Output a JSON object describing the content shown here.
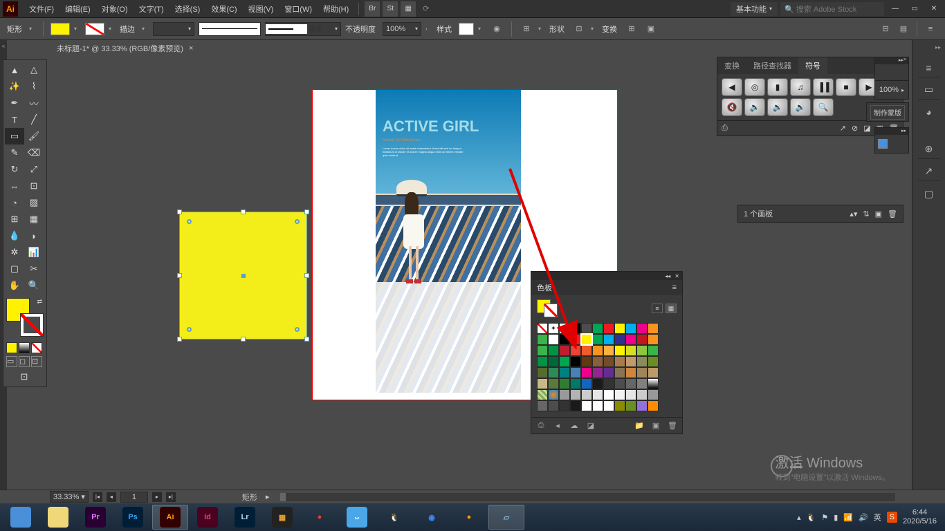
{
  "menubar": {
    "items": [
      "文件(F)",
      "编辑(E)",
      "对象(O)",
      "文字(T)",
      "选择(S)",
      "效果(C)",
      "视图(V)",
      "窗口(W)",
      "帮助(H)"
    ],
    "bridge": "Br",
    "stock": "St",
    "workspace": "基本功能",
    "search_placeholder": "搜索 Adobe Stock"
  },
  "control": {
    "shape_label": "矩形",
    "fill_color": "#fff200",
    "stroke_label": "描边",
    "stroke_weight": "",
    "stroke_style": "基本",
    "opacity_label": "不透明度",
    "opacity_value": "100%",
    "style_label": "样式",
    "align_label": "形状",
    "transform_label": "变换"
  },
  "tab": {
    "title": "未标题-1* @ 33.33% (RGB/像素预览)"
  },
  "tools": {
    "rows": [
      [
        "selection",
        "direct-selection"
      ],
      [
        "magic-wand",
        "lasso"
      ],
      [
        "pen",
        "curvature"
      ],
      [
        "type",
        "line"
      ],
      [
        "rectangle",
        "brush"
      ],
      [
        "shaper",
        "eraser"
      ],
      [
        "rotate",
        "scale"
      ],
      [
        "width",
        "free-transform"
      ],
      [
        "shape-builder",
        "perspective"
      ],
      [
        "mesh",
        "gradient"
      ],
      [
        "eyedropper",
        "blend"
      ],
      [
        "symbol-sprayer",
        "graph"
      ],
      [
        "artboard",
        "slice"
      ],
      [
        "hand",
        "zoom"
      ]
    ],
    "active": "rectangle",
    "fill_color": "#fff200",
    "mini_colors": [
      "#000000",
      "#ffffff",
      "none"
    ]
  },
  "canvas": {
    "poster_title": "ACTIVE GIRL",
    "poster_subtitle": "Actively Girl With Dream",
    "yellow_rect_color": "#f3ed19"
  },
  "swatches": {
    "tab": "色板",
    "colors_row1": [
      "none",
      "reg",
      "#ffffff",
      "#000000",
      "#4d4d4d",
      "#00a651",
      "#ed1c24",
      "#fff200",
      "#00aeef",
      "#ec008c",
      "#f7941d",
      "#39b54a"
    ],
    "colors_row2": [
      "#ffffff",
      "#000000",
      "#ed1c24",
      "#fff200",
      "#00a651",
      "#00aeef",
      "#2e3192",
      "#ec008c",
      "#c4161c",
      "#f7941d",
      "#39b54a",
      "#009444"
    ],
    "colors_row3": [
      "#be1e2d",
      "#ef4136",
      "#f15a29",
      "#f7941d",
      "#fbb040",
      "#fff200",
      "#d7df23",
      "#8dc63f",
      "#39b54a",
      "#009444",
      "#006838",
      "#00a651"
    ],
    "colors_row4": [
      "#000000",
      "#603913",
      "#8b5e3c",
      "#754c29",
      "#a97c50",
      "#c49a6c",
      "#8a8a5c",
      "#6b8e23",
      "#556b2f",
      "#2e8b57",
      "#008080",
      "#4682b4"
    ],
    "colors_row5": [
      "#ec008c",
      "#92278f",
      "#662d91",
      "#8b7355",
      "#cd853f",
      "#a0845c",
      "#bc9a6a",
      "#c8b88a",
      "#5a7a3a",
      "#2e7d32",
      "#00796b",
      "#1565c0"
    ],
    "colors_row6": [
      "#1a1a1a",
      "#333333",
      "#4d4d4d",
      "#666666",
      "#808080",
      "grad1",
      "patt1",
      "patt2",
      "#999999",
      "#b3b3b3",
      "#cccccc",
      "#e6e6e6"
    ],
    "colors_row7": [
      "#ffffff",
      "#f2f2f2",
      "#e6e6e6",
      "#cccccc",
      "#999999",
      "#666666",
      "#4d4d4d",
      "#333333",
      "#1a1a1a",
      "#ffffff",
      "#ffffff",
      "#ffffff"
    ],
    "colors_row8": [
      "#8b8b00",
      "#6b8e23",
      "#9370db",
      "#ff8c00"
    ],
    "selected_index": 15
  },
  "right_panels": {
    "tabs1": [
      "变换",
      "路径查找器",
      "符号"
    ],
    "active_tab1": "符号",
    "symbols": [
      "◀",
      "◎",
      "▮",
      "♫",
      "▐▐",
      "■",
      "▶",
      "🔇",
      "🔈",
      "🔉",
      "🔊",
      "🔍"
    ],
    "mini_zoom": "100%",
    "mini_btn": "制作蒙版",
    "artboard_label": "1 个画板"
  },
  "status": {
    "zoom": "33.33%",
    "artboard_nav": "1",
    "tool_name": "矩形"
  },
  "watermark": {
    "title": "激活 Windows",
    "sub": "转到\"电脑设置\"以激活 Windows。"
  },
  "taskbar": {
    "items": [
      {
        "name": "browser",
        "bg": "#4a90d9",
        "txt": "",
        "active": false
      },
      {
        "name": "explorer",
        "bg": "#f0d878",
        "txt": "",
        "active": false
      },
      {
        "name": "premiere",
        "bg": "#2a0033",
        "txt": "Pr",
        "color": "#e878ff",
        "active": false
      },
      {
        "name": "photoshop",
        "bg": "#001e36",
        "txt": "Ps",
        "color": "#31a8ff",
        "active": false
      },
      {
        "name": "illustrator",
        "bg": "#330000",
        "txt": "Ai",
        "color": "#ff9a00",
        "active": true
      },
      {
        "name": "indesign",
        "bg": "#49021f",
        "txt": "Id",
        "color": "#ff3366",
        "active": false
      },
      {
        "name": "lightroom",
        "bg": "#001e36",
        "txt": "Lr",
        "color": "#b4dcf0",
        "active": false
      },
      {
        "name": "app1",
        "bg": "#222",
        "txt": "▦",
        "color": "#e8a030",
        "active": false
      },
      {
        "name": "ball",
        "bg": "transparent",
        "txt": "●",
        "color": "#e84030",
        "active": false
      },
      {
        "name": "app2",
        "bg": "#4aa8e8",
        "txt": "ᴗ",
        "color": "#fff",
        "active": false
      },
      {
        "name": "qq",
        "bg": "transparent",
        "txt": "🐧",
        "color": "#333",
        "active": false
      },
      {
        "name": "chrome",
        "bg": "transparent",
        "txt": "◉",
        "color": "#4285f4",
        "active": false
      },
      {
        "name": "firefox",
        "bg": "transparent",
        "txt": "●",
        "color": "#ff9500",
        "active": false
      },
      {
        "name": "notes",
        "bg": "transparent",
        "txt": "▱",
        "color": "#88c0e8",
        "active": true
      }
    ],
    "tray_lang": "英",
    "time": "6:44",
    "date": "2020/5/16"
  }
}
